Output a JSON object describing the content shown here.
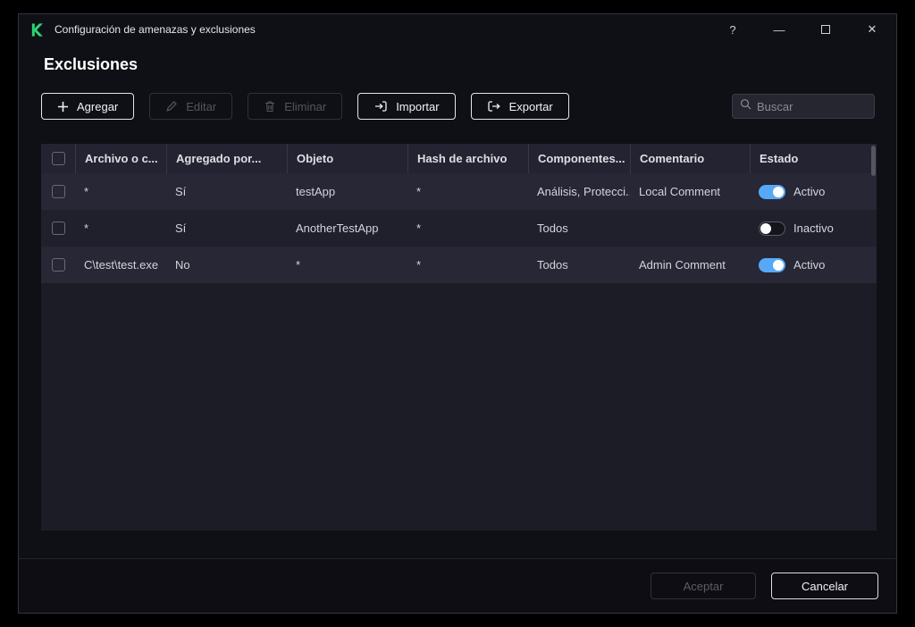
{
  "window": {
    "title": "Configuración de amenazas y exclusiones",
    "help": "?",
    "minimize": "—",
    "close": "✕"
  },
  "page": {
    "title": "Exclusiones"
  },
  "toolbar": {
    "add": "Agregar",
    "edit": "Editar",
    "delete": "Eliminar",
    "import": "Importar",
    "export": "Exportar"
  },
  "search": {
    "placeholder": "Buscar"
  },
  "table": {
    "columns": [
      "Archivo o c...",
      "Agregado por...",
      "Objeto",
      "Hash de archivo",
      "Componentes...",
      "Comentario",
      "Estado"
    ],
    "rows": [
      {
        "archivo": "*",
        "agregado": "Sí",
        "objeto": "testApp",
        "hash": "*",
        "componentes": "Análisis, Protecci...",
        "comentario": "Local Comment",
        "estado": "Activo",
        "active": true
      },
      {
        "archivo": "*",
        "agregado": "Sí",
        "objeto": "AnotherTestApp",
        "hash": "*",
        "componentes": "Todos",
        "comentario": "",
        "estado": "Inactivo",
        "active": false
      },
      {
        "archivo": "C\\test\\test.exe",
        "agregado": "No",
        "objeto": "*",
        "hash": "*",
        "componentes": "Todos",
        "comentario": "Admin Comment",
        "estado": "Activo",
        "active": true
      }
    ]
  },
  "footer": {
    "accept": "Aceptar",
    "cancel": "Cancelar"
  },
  "colors": {
    "toggle_active": "#57a9f7",
    "brand_green": "#2bd673"
  }
}
